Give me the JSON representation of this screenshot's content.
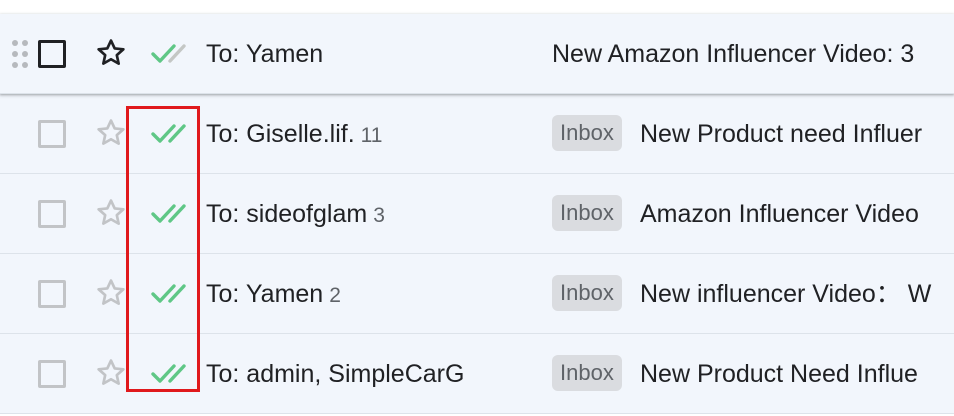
{
  "colors": {
    "row_background": "#f2f6fc",
    "read_tick_green": "#5fc786",
    "unread_tick_grey": "#c4c7c5",
    "label_chip_background": "#dadce0",
    "highlight_border": "#e0191c"
  },
  "icons": {
    "drag": "drag-handle-icon",
    "checkbox": "checkbox-icon",
    "star": "star-outline-icon",
    "status": "double-check-icon"
  },
  "rows": [
    {
      "recipient": "To: Yamen",
      "count": "",
      "label": "",
      "subject": "New Amazon Influencer Video: 3",
      "ticks": "partial"
    },
    {
      "recipient": "To: Giselle.lif.",
      "count": "11",
      "label": "Inbox",
      "subject": "New Product need Influer",
      "ticks": "read"
    },
    {
      "recipient": "To: sideofglam",
      "count": "3",
      "label": "Inbox",
      "subject": "Amazon Influencer Video",
      "ticks": "read"
    },
    {
      "recipient": "To: Yamen",
      "count": "2",
      "label": "Inbox",
      "subject": "New influencer Video：  W",
      "ticks": "read"
    },
    {
      "recipient": "To: admin, SimpleCarG",
      "count": "",
      "label": "Inbox",
      "subject": "New Product Need Influe",
      "ticks": "read"
    }
  ]
}
